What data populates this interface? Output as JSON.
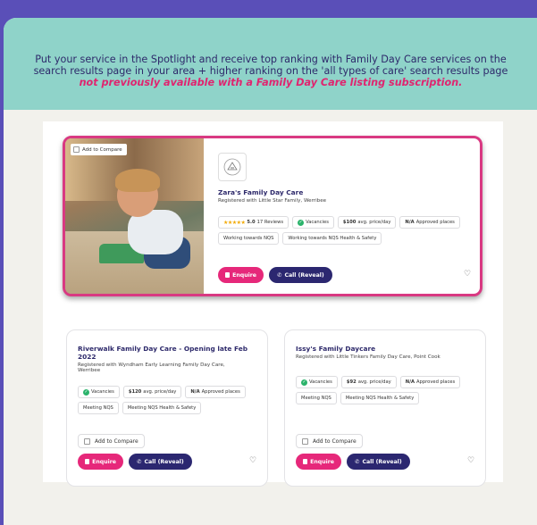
{
  "banner": {
    "line1": "Put your service in the Spotlight and receive top ranking with Family Day Care services on the",
    "line2": "search results page in your area + higher ranking on the 'all types of care' search results page",
    "highlight": "not previously available with a Family Day Care listing subscription."
  },
  "featured": {
    "add_to_compare": "Add to Compare",
    "name": "Zara's Family Day Care",
    "registered": "Registered with Little Star Family, Werribee",
    "rating": "5.0",
    "reviews": "17 Reviews",
    "vacancies": "Vacancies",
    "price": "$100",
    "price_unit": "avg. price/day",
    "approved": "N/A",
    "approved_label": "Approved places",
    "nqs1": "Working towards NQS",
    "nqs2": "Working towards NQS Health & Safety",
    "enquire": "Enquire",
    "call": "Call (Reveal)"
  },
  "cards": [
    {
      "name": "Riverwalk Family Day Care - Opening late Feb 2022",
      "registered_1": "Registered with Wyndham Early Learning Family Day Care,",
      "registered_2": "Werribee",
      "vacancies": "Vacancies",
      "price": "$120",
      "price_unit": "avg. price/day",
      "approved": "N/A",
      "approved_label": "Approved places",
      "nqs1": "Meeting NQS",
      "nqs2": "Meeting NQS Health & Safety",
      "add_to_compare": "Add to Compare",
      "enquire": "Enquire",
      "call": "Call (Reveal)"
    },
    {
      "name": "Issy's Family Daycare",
      "registered_1": "Registered with Little Tinkers Family Day Care, Point Cook",
      "vacancies": "Vacancies",
      "price": "$92",
      "price_unit": "avg. price/day",
      "approved": "N/A",
      "approved_label": "Approved places",
      "nqs1": "Meeting NQS",
      "nqs2": "Meeting NQS Health & Safety",
      "add_to_compare": "Add to Compare",
      "enquire": "Enquire",
      "call": "Call (Reveal)"
    }
  ],
  "colors": {
    "background": "#5a4fb8",
    "banner": "#8fd3c9",
    "accent_pink": "#e6287a",
    "navy": "#2b2770"
  },
  "icons": [
    "checkbox-icon",
    "logo-icon",
    "star-icon",
    "check-icon",
    "enquire-icon",
    "phone-icon",
    "heart-icon"
  ]
}
